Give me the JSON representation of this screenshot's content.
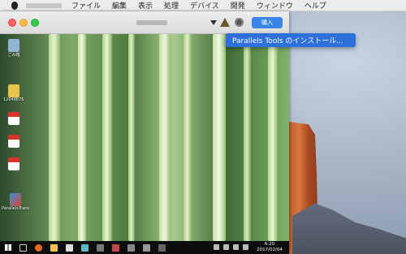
{
  "menubar": {
    "apple": "apple-icon",
    "items": [
      "ファイル",
      "編集",
      "表示",
      "処理",
      "デバイス",
      "開発",
      "ウィンドウ",
      "ヘルプ"
    ]
  },
  "window": {
    "buy_label": "購入"
  },
  "popup": {
    "label": "Parallels Tools のインストール..."
  },
  "desktop_icons": [
    {
      "label": "ごみ箱",
      "color": "#8fb4d8"
    },
    {
      "label": "1264867684",
      "color": "#e8c44b"
    },
    {
      "label": "",
      "color": "#d6332a"
    },
    {
      "label": "",
      "color": "#d6332a"
    },
    {
      "label": "",
      "color": "#d6332a"
    },
    {
      "label": "ParallelsTranspo...",
      "color": "#d9453a"
    }
  ],
  "taskbar": {
    "time": "6:20",
    "date": "2017/02/04"
  },
  "colors": {
    "accent": "#2d6fdb",
    "buy_button": "#3a86e8"
  }
}
